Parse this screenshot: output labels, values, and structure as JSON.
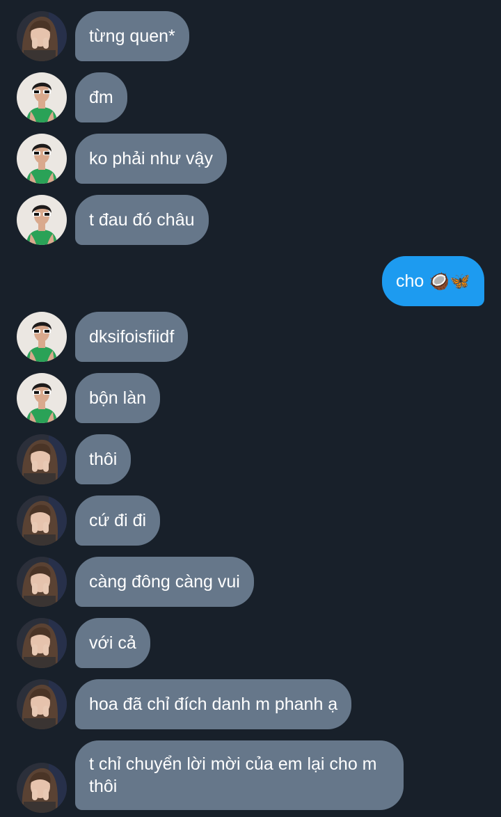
{
  "conversation": {
    "messages": [
      {
        "sender": "friend-a",
        "text": "từng quen*"
      },
      {
        "sender": "friend-b",
        "text": "đm"
      },
      {
        "sender": "friend-b",
        "text": "ko phải như vậy"
      },
      {
        "sender": "friend-b",
        "text": "t đau đó châu"
      },
      {
        "sender": "me",
        "text": "cho",
        "emoji": [
          "coconut",
          "butterfly"
        ]
      },
      {
        "sender": "friend-b",
        "text": "dksifoisfiidf"
      },
      {
        "sender": "friend-b",
        "text": "bộn làn"
      },
      {
        "sender": "friend-a",
        "text": "thôi"
      },
      {
        "sender": "friend-a",
        "text": "cứ đi đi"
      },
      {
        "sender": "friend-a",
        "text": "càng đông càng vui"
      },
      {
        "sender": "friend-a",
        "text": "với cả"
      },
      {
        "sender": "friend-a",
        "text": "hoa đã chỉ đích danh m phanh ạ"
      },
      {
        "sender": "friend-a",
        "text": "t chỉ chuyển lời mời của em lại cho m thôi"
      }
    ]
  },
  "colors": {
    "background": "#18202a",
    "received_bubble": "#66778a",
    "sent_bubble": "#1d9bf0",
    "text": "#ffffff"
  }
}
